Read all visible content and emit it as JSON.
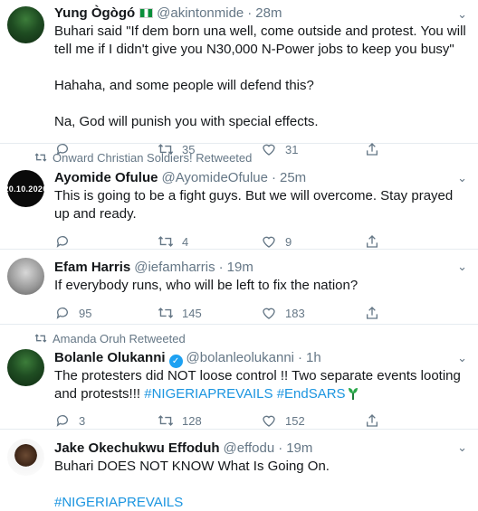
{
  "tweets": [
    {
      "name": "Yung Ògògó",
      "flag": "nigeria-flag-emoji",
      "handle": "@akintonmide",
      "separator": "·",
      "time": "28m",
      "paragraphs": [
        "Buhari said \"If dem born una well, come outside and protest. You will tell me if I didn't give you N30,000 N-Power jobs to keep you busy\"",
        "Hahaha, and some people will defend this?",
        "Na, God will punish you with special effects."
      ],
      "reply_count": "",
      "retweet_count": "35",
      "like_count": "31"
    },
    {
      "social_context": "Onward Christian Soldiers! Retweeted",
      "avatar_text": "20.10.2020",
      "name": "Ayomide Ofulue",
      "handle": "@AyomideOfulue",
      "separator": "·",
      "time": "25m",
      "paragraphs": [
        "This is going to be a fight guys. But we will overcome. Stay prayed up and ready."
      ],
      "reply_count": "",
      "retweet_count": "4",
      "like_count": "9"
    },
    {
      "name": "Efam Harris",
      "handle": "@iefamharris",
      "separator": "·",
      "time": "19m",
      "paragraphs": [
        "If everybody runs, who will be left to fix the nation?"
      ],
      "reply_count": "95",
      "retweet_count": "145",
      "like_count": "183"
    },
    {
      "social_context": "Amanda Oruh Retweeted",
      "name": "Bolanle Olukanni",
      "verified": "verified-badge",
      "handle": "@bolanleolukanni",
      "separator": "·",
      "time": "1h",
      "text_plain": "The protesters did NOT loose control !! Two separate events looting and protests!!! ",
      "hashtag_1": "#NIGERIAPREVAILS",
      "hashtag_2": "#EndSARS",
      "reply_count": "3",
      "retweet_count": "128",
      "like_count": "152"
    },
    {
      "name": "Jake Okechukwu Effoduh",
      "handle": "@effodu",
      "separator": "·",
      "time": "19m",
      "paragraphs": [
        "Buhari DOES NOT KNOW What Is Going On."
      ],
      "hashtag": "#NIGERIAPREVAILS"
    }
  ],
  "colors": {
    "link": "#1b95e0",
    "muted": "#657786",
    "text": "#14171a",
    "divider": "#e6ecf0"
  }
}
